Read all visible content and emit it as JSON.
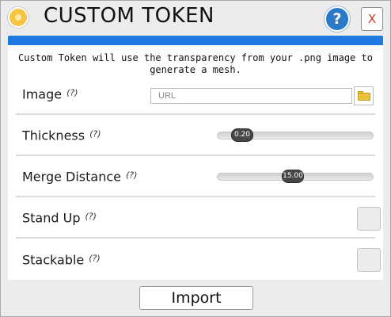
{
  "window": {
    "title": "CUSTOM TOKEN",
    "help_label": "?",
    "close_label": "X",
    "accent_color": "#1e7ae0"
  },
  "description": "Custom Token will use the transparency from your .png image to generate a mesh.",
  "fields": {
    "image": {
      "label": "Image",
      "help": "(?)",
      "value": "",
      "placeholder": "URL",
      "browse_icon": "folder-icon"
    },
    "thickness": {
      "label": "Thickness",
      "help": "(?)",
      "value": "0.20"
    },
    "merge_distance": {
      "label": "Merge Distance",
      "help": "(?)",
      "value": "15.00"
    },
    "stand_up": {
      "label": "Stand Up",
      "help": "(?)",
      "checked": false
    },
    "stackable": {
      "label": "Stackable",
      "help": "(?)",
      "checked": false
    }
  },
  "footer": {
    "import_label": "Import"
  }
}
